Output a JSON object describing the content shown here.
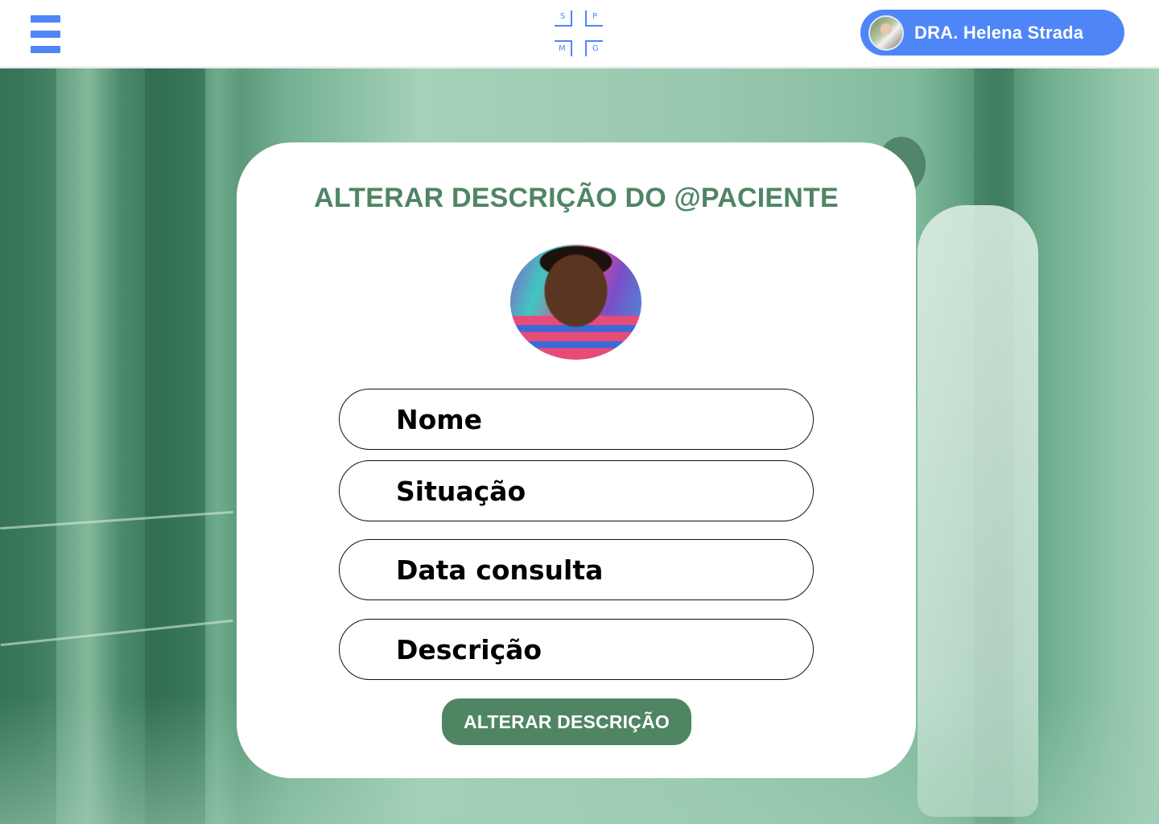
{
  "header": {
    "menu_icon": "hamburger-menu-icon",
    "logo": {
      "letters": [
        "S",
        "P",
        "M",
        "G"
      ]
    },
    "user": {
      "name": "DRA. Helena Strada",
      "avatar_icon": "doctor-avatar"
    }
  },
  "card": {
    "title": "ALTERAR DESCRIÇÃO DO @PACIENTE",
    "photo_icon": "patient-photo",
    "fields": [
      {
        "placeholder": "Nome"
      },
      {
        "placeholder": "Situação"
      },
      {
        "placeholder": "Data consulta"
      },
      {
        "placeholder": "Descrição"
      }
    ],
    "submit_label": "ALTERAR DESCRIÇÃO"
  },
  "colors": {
    "accent_blue": "#4f86f7",
    "accent_green": "#4f8563",
    "card_bg": "#ffffff"
  }
}
